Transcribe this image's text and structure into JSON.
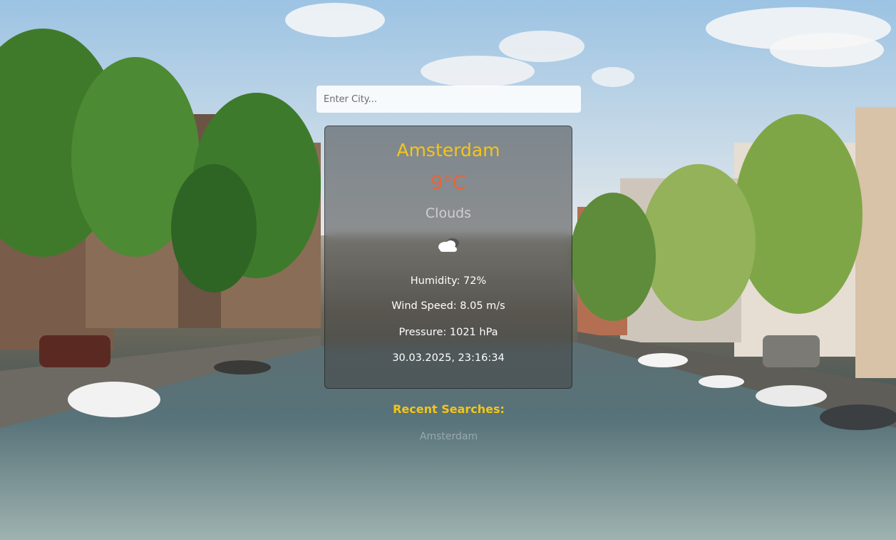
{
  "search": {
    "placeholder": "Enter City..."
  },
  "weather": {
    "city": "Amsterdam",
    "temperature": "9°C",
    "condition": "Clouds",
    "icon": "cloud-icon",
    "humidity": "Humidity: 72%",
    "wind_speed": "Wind Speed: 8.05 m/s",
    "pressure": "Pressure: 1021 hPa",
    "datetime": "30.03.2025, 23:16:34"
  },
  "recent": {
    "title": "Recent Searches:",
    "items": [
      "Amsterdam"
    ]
  },
  "colors": {
    "city": "#f5c518",
    "temperature": "#e8643a",
    "recent_title": "#f5c518"
  }
}
